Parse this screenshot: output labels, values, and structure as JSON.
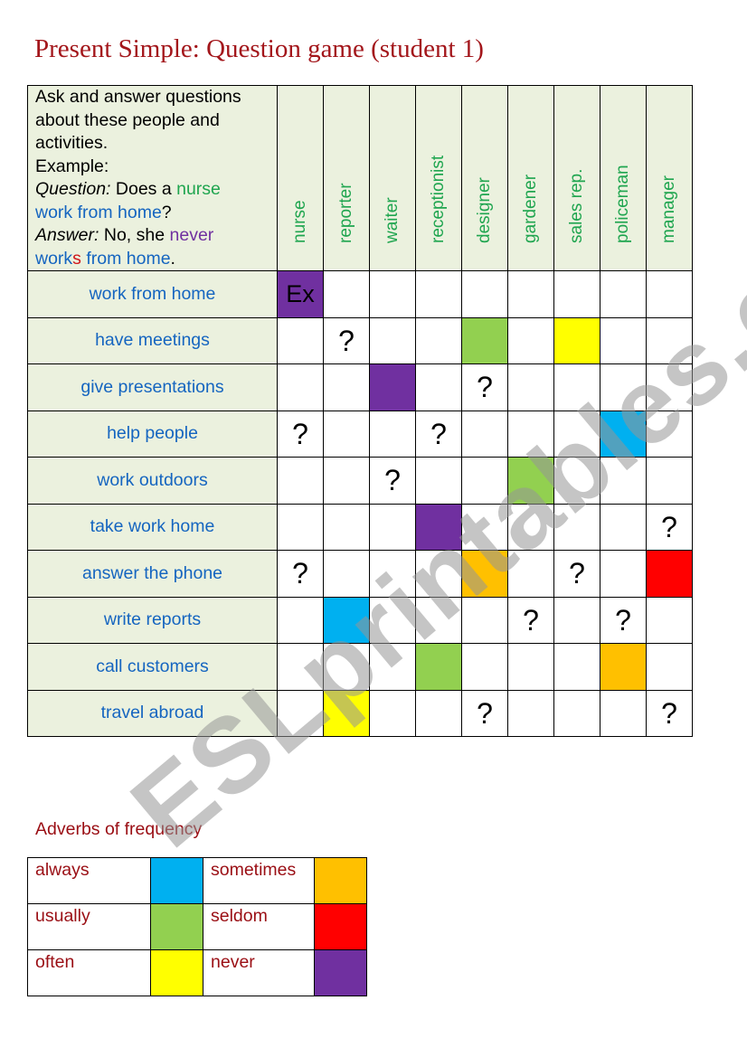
{
  "title": "Present Simple:  Question game (student 1)",
  "intro": {
    "line1": "Ask and answer questions",
    "line2": "about these people and",
    "line3": "activities.",
    "line4": "Example:",
    "q_label": "Question:",
    "q_text1": " Does a ",
    "q_nurse": "nurse",
    "q_work": "work from home",
    "q_end": "?",
    "a_label": "Answer:",
    "a_text1": " No, she ",
    "a_never": "never",
    "a_work": "work",
    "a_s": "s",
    "a_rest": " from home",
    "a_end": "."
  },
  "colors": {
    "blue": "#00b0f0",
    "green": "#92d050",
    "yellow": "#ffff00",
    "orange": "#ffc000",
    "red": "#ff0000",
    "purple": "#7030a0",
    "header_bg": "#ebf1de",
    "title": "#a3161b",
    "activity_text": "#1565c0",
    "job_text": "#1fa54f"
  },
  "jobs": [
    "nurse",
    "reporter",
    "waiter",
    "receptionist",
    "designer",
    "gardener",
    "sales rep.",
    "policeman",
    "manager"
  ],
  "rows": [
    {
      "activity": "work from home",
      "cells": [
        "Ex:purple",
        "",
        "",
        "",
        "",
        "",
        "",
        "",
        ""
      ]
    },
    {
      "activity": "have meetings",
      "cells": [
        "",
        "?",
        "",
        "",
        ":green",
        "",
        ":yellow",
        "",
        ""
      ]
    },
    {
      "activity": "give presentations",
      "cells": [
        "",
        "",
        ":purple",
        "",
        "?",
        "",
        "",
        "",
        ""
      ]
    },
    {
      "activity": "help people",
      "cells": [
        "?",
        "",
        "",
        "?",
        "",
        "",
        "",
        ":blue",
        ""
      ]
    },
    {
      "activity": "work outdoors",
      "cells": [
        "",
        "",
        "?",
        "",
        "",
        ":green",
        "",
        "",
        ""
      ]
    },
    {
      "activity": "take work home",
      "cells": [
        "",
        "",
        "",
        ":purple",
        "",
        "",
        "",
        "",
        "?"
      ]
    },
    {
      "activity": "answer the phone",
      "cells": [
        "?",
        "",
        "",
        "",
        ":orange",
        "",
        "?",
        "",
        ":red"
      ]
    },
    {
      "activity": "write reports",
      "cells": [
        "",
        ":blue",
        "",
        "",
        "",
        "?",
        "",
        "?",
        ""
      ]
    },
    {
      "activity": "call customers",
      "cells": [
        "",
        "",
        "",
        ":green",
        "",
        "",
        "",
        ":orange",
        ""
      ]
    },
    {
      "activity": "travel abroad",
      "cells": [
        "",
        ":yellow",
        "",
        "",
        "?",
        "",
        "",
        "",
        "?"
      ]
    }
  ],
  "legend": {
    "title": "Adverbs of frequency",
    "rows": [
      [
        {
          "label": "always",
          "color": "blue"
        },
        {
          "label": "sometimes",
          "color": "orange"
        }
      ],
      [
        {
          "label": "usually",
          "color": "green"
        },
        {
          "label": "seldom",
          "color": "red"
        }
      ],
      [
        {
          "label": "often",
          "color": "yellow"
        },
        {
          "label": "never",
          "color": "purple"
        }
      ]
    ]
  },
  "watermark": "ESLprintables.com"
}
